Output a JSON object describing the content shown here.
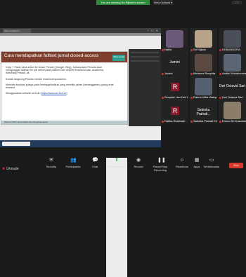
{
  "topbar": {
    "share_notice": "You are viewing Sri Rijkiah's screen",
    "view_options": "View Options ▾",
    "zoom": "⛶"
  },
  "browser": {
    "tab_label": "forum.modul.id ×",
    "controls": "─ ☐ ✕"
  },
  "slide": {
    "title": "Cara mendapatkan fulltext jurnal closed-access",
    "badge": "Mitra Jurnal",
    "paragraphs": [
      "Copy + Paste judul artikel ke Mesin Pencari (Google, Bing), Kebanyakan Penulis akan mengunggah salinan file pdf artikel pada platform lain seperti ResearchGate, Academia, Web/Blog Pribadi, dll.",
      "Kontak langsung Penulis melalui email korespondensi",
      "Meminta bantuan kolega pada lembaga/institusi yang memiliki akses (berlangganan) pada jurnal tersebut",
      "Menggunakan website sci-hub ("
    ],
    "link": "https://www.sci-hub.se",
    "link_suffix": ")",
    "footer": "Mitra SI 2021 | Menerbitkan dan Mengelola Jurnal"
  },
  "gallery": {
    "tiles": [
      {
        "name": "Nafila",
        "type": "camera",
        "color": "#6d5a7a"
      },
      {
        "name": "Sri Rijkiah",
        "type": "camera",
        "color": "#b8a28a"
      },
      {
        "name": "OKBANGGRA",
        "type": "camera",
        "color": "#4a4f5a"
      },
      {
        "name": "Jumini",
        "type": "name",
        "label": "Jumini"
      },
      {
        "name": "Mirtarani Rasyida",
        "type": "camera",
        "color": "#5a4a3f"
      },
      {
        "name": "Andini Mokobombang",
        "type": "camera",
        "color": "#5b6675"
      },
      {
        "name": "Resyida Lisn Dwi Cahaya",
        "type": "avatar",
        "letter": "R"
      },
      {
        "name": "Rahmi Ulilia Wahyuni",
        "type": "camera",
        "color": "#556070"
      },
      {
        "name": "Dwi Octavia Sari",
        "type": "name",
        "label": "Dwi Octavia Sari"
      },
      {
        "name": "Rafika Rusfimah",
        "type": "avatar",
        "letter": "R"
      },
      {
        "name": "Saleska Prahati Erly",
        "type": "name",
        "label": "Saleska Prahati..."
      },
      {
        "name": "Emma Sri Kusumawati",
        "type": "camera",
        "color": "#8a7d6a"
      }
    ],
    "next_page": "›"
  },
  "toolbar": {
    "unmute": "Unmute",
    "items": [
      {
        "label": "Security",
        "icon": "shield-icon",
        "glyph": "⛨"
      },
      {
        "label": "Participants",
        "icon": "participants-icon",
        "glyph": "👥"
      },
      {
        "label": "Chat",
        "icon": "chat-icon",
        "glyph": "💬"
      },
      {
        "label": "Share Screen",
        "icon": "share-screen-icon",
        "glyph": "⬆"
      },
      {
        "label": "Record",
        "icon": "record-icon",
        "glyph": "◉"
      },
      {
        "label": "Pause/Stop Recording",
        "icon": "pause-icon",
        "glyph": "❚❚"
      },
      {
        "label": "Reactions",
        "icon": "reactions-icon",
        "glyph": "☺"
      },
      {
        "label": "Apps",
        "icon": "apps-icon",
        "glyph": "▦"
      },
      {
        "label": "Whiteboards",
        "icon": "whiteboard-icon",
        "glyph": "▭"
      }
    ],
    "end": "End"
  }
}
